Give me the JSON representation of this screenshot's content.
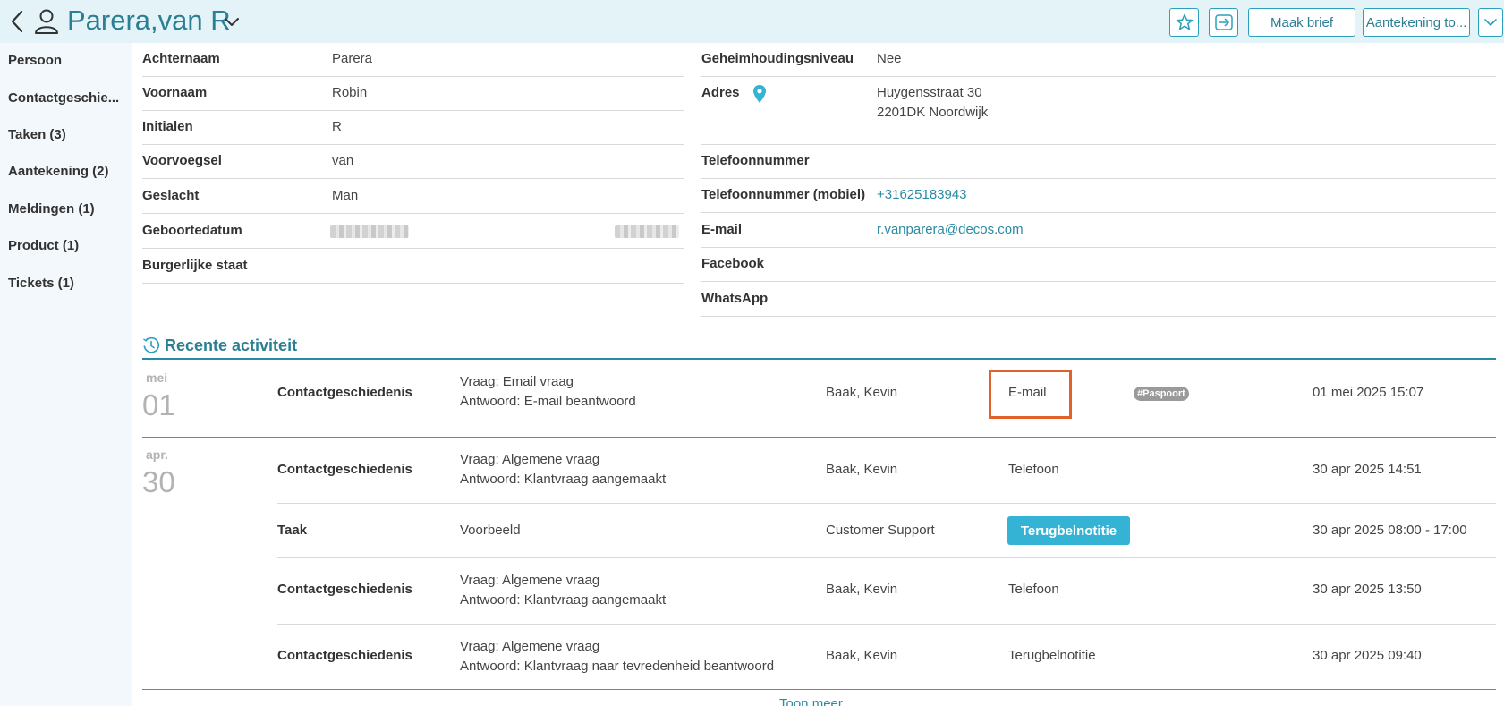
{
  "header": {
    "title": "Parera,van R",
    "buttons": {
      "letter": "Maak brief",
      "note": "Aantekening to..."
    }
  },
  "sidebar": {
    "items": [
      {
        "label": "Persoon"
      },
      {
        "label": "Contactgeschie..."
      },
      {
        "label": "Taken (3)"
      },
      {
        "label": "Aantekening (2)"
      },
      {
        "label": "Meldingen (1)"
      },
      {
        "label": "Product (1)"
      },
      {
        "label": "Tickets (1)"
      }
    ]
  },
  "person": {
    "left": [
      {
        "label": "Achternaam",
        "value": "Parera"
      },
      {
        "label": "Voornaam",
        "value": "Robin"
      },
      {
        "label": "Initialen",
        "value": "R"
      },
      {
        "label": "Voorvoegsel",
        "value": "van"
      },
      {
        "label": "Geslacht",
        "value": "Man"
      },
      {
        "label": "Geboortedatum",
        "value": ""
      },
      {
        "label": "Burgerlijke staat",
        "value": ""
      }
    ],
    "right": [
      {
        "label": "Geheimhoudingsniveau",
        "value": "Nee"
      },
      {
        "label": "Adres",
        "line1": "Huygensstraat 30",
        "line2": "2201DK Noordwijk"
      },
      {
        "label": "Telefoonnummer",
        "value": ""
      },
      {
        "label": "Telefoonnummer (mobiel)",
        "value": "+31625183943"
      },
      {
        "label": "E-mail",
        "value": "r.vanparera@decos.com"
      },
      {
        "label": "Facebook",
        "value": ""
      },
      {
        "label": "WhatsApp",
        "value": ""
      }
    ]
  },
  "activity": {
    "title": "Recente activiteit",
    "groups": [
      {
        "month": "mei",
        "day": "01"
      },
      {
        "month": "apr.",
        "day": "30"
      }
    ],
    "items": [
      {
        "type": "Contactgeschiedenis",
        "line1": "Vraag: Email vraag",
        "line2": "Antwoord: E-mail beantwoord",
        "person": "Baak, Kevin",
        "channel": "E-mail",
        "tag": "#Paspoort",
        "date": "01 mei 2025 15:07"
      },
      {
        "type": "Contactgeschiedenis",
        "line1": "Vraag: Algemene vraag",
        "line2": "Antwoord: Klantvraag aangemaakt",
        "person": "Baak, Kevin",
        "channel": "Telefoon",
        "date": "30 apr 2025 14:51"
      },
      {
        "type": "Taak",
        "line1": "Voorbeeld",
        "person": "Customer Support",
        "channel": "Terugbelnotitie",
        "date": "30 apr 2025 08:00 - 17:00"
      },
      {
        "type": "Contactgeschiedenis",
        "line1": "Vraag: Algemene vraag",
        "line2": "Antwoord: Klantvraag aangemaakt",
        "person": "Baak, Kevin",
        "channel": "Telefoon",
        "date": "30 apr 2025 13:50"
      },
      {
        "type": "Contactgeschiedenis",
        "line1": "Vraag: Algemene vraag",
        "line2": "Antwoord: Klantvraag naar tevredenheid beantwoord",
        "person": "Baak, Kevin",
        "channel": "Terugbelnotitie",
        "date": "30 apr 2025 09:40"
      }
    ],
    "show_more": "Toon meer"
  },
  "colors": {
    "accent": "#2a7f93",
    "header_bg": "#e3f3f7",
    "sidebar_bg": "#f2f8fb",
    "badge": "#34b3d4",
    "highlight": "#e0612a"
  }
}
